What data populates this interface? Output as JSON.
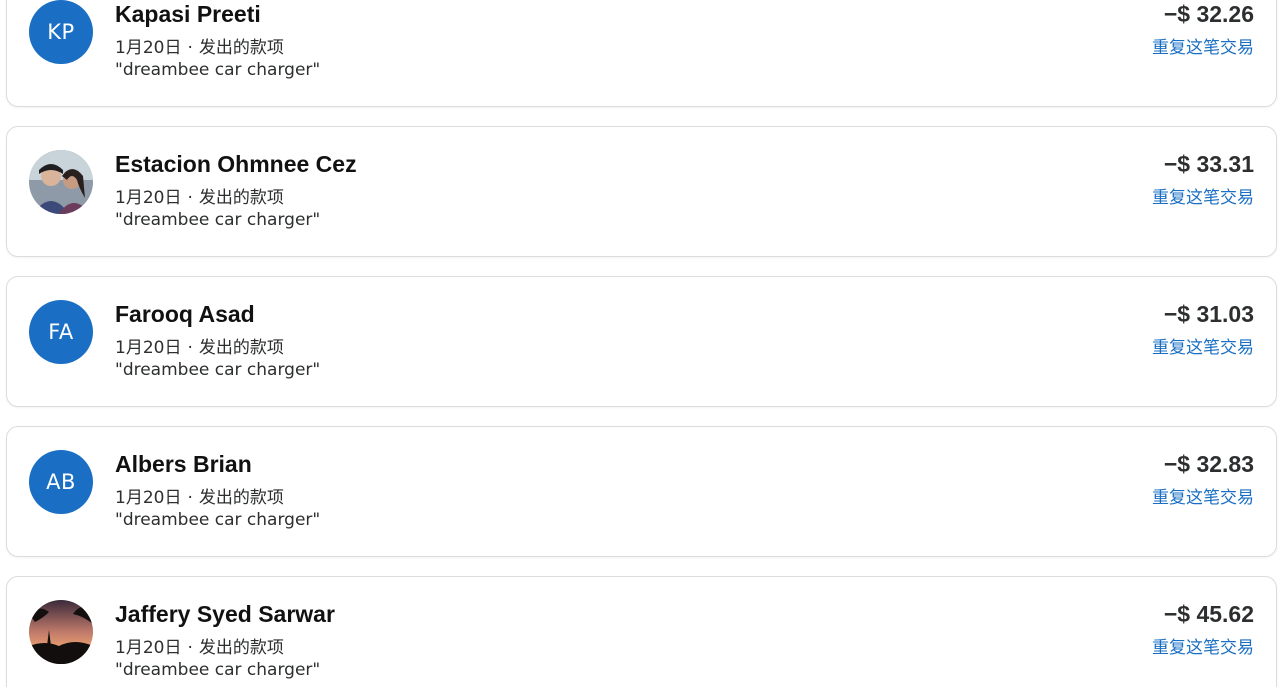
{
  "transactions": [
    {
      "name": "Kapasi Preeti",
      "date": "1月20日",
      "separator": "·",
      "type": "发出的款项",
      "note": "\"dreambee car charger\"",
      "amount": "−$ 32.26",
      "repeat_label": "重复这笔交易",
      "avatar": {
        "kind": "initials",
        "text": "KP"
      }
    },
    {
      "name": "Estacion Ohmnee Cez",
      "date": "1月20日",
      "separator": "·",
      "type": "发出的款项",
      "note": "\"dreambee car charger\"",
      "amount": "−$ 33.31",
      "repeat_label": "重复这笔交易",
      "avatar": {
        "kind": "photo",
        "text": ""
      }
    },
    {
      "name": "Farooq Asad",
      "date": "1月20日",
      "separator": "·",
      "type": "发出的款项",
      "note": "\"dreambee car charger\"",
      "amount": "−$ 31.03",
      "repeat_label": "重复这笔交易",
      "avatar": {
        "kind": "initials",
        "text": "FA"
      }
    },
    {
      "name": "Albers Brian",
      "date": "1月20日",
      "separator": "·",
      "type": "发出的款项",
      "note": "\"dreambee car charger\"",
      "amount": "−$ 32.83",
      "repeat_label": "重复这笔交易",
      "avatar": {
        "kind": "initials",
        "text": "AB"
      }
    },
    {
      "name": "Jaffery Syed Sarwar",
      "date": "1月20日",
      "separator": "·",
      "type": "发出的款项",
      "note": "\"dreambee car charger\"",
      "amount": "−$ 45.62",
      "repeat_label": "重复这笔交易",
      "avatar": {
        "kind": "photo",
        "text": ""
      }
    }
  ],
  "colors": {
    "avatar_blue": "#1a6fc4",
    "link_blue": "#1a6fc4",
    "text_dark": "#2c2e2f"
  }
}
